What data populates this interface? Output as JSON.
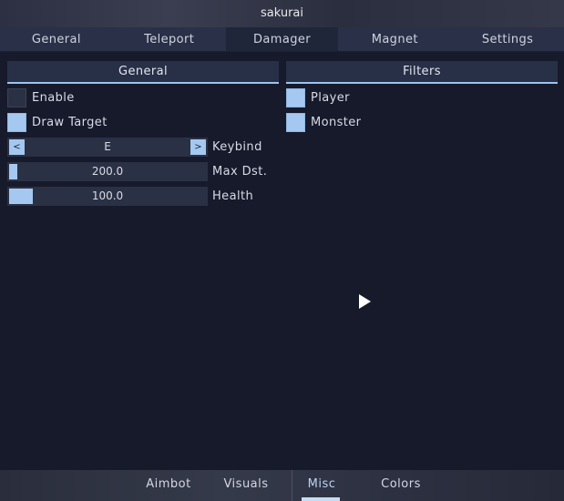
{
  "window": {
    "title": "sakurai"
  },
  "tabs": [
    {
      "label": "General"
    },
    {
      "label": "Teleport"
    },
    {
      "label": "Damager",
      "active": true
    },
    {
      "label": "Magnet"
    },
    {
      "label": "Settings"
    }
  ],
  "general_panel": {
    "title": "General",
    "enable": {
      "label": "Enable",
      "checked": false
    },
    "draw_target": {
      "label": "Draw Target",
      "checked": true
    },
    "keybind": {
      "label": "Keybind",
      "value": "E",
      "left_arrow": "<",
      "right_arrow": ">"
    },
    "max_dst": {
      "label": "Max Dst.",
      "value": "200.0",
      "fill_fraction": 0.04
    },
    "health": {
      "label": "Health",
      "value": "100.0",
      "fill_fraction": 0.12
    }
  },
  "filters_panel": {
    "title": "Filters",
    "player": {
      "label": "Player",
      "checked": true
    },
    "monster": {
      "label": "Monster",
      "checked": true
    }
  },
  "bottom_tabs": [
    {
      "label": "Aimbot"
    },
    {
      "label": "Visuals"
    },
    {
      "label": "Misc",
      "active": true
    },
    {
      "label": "Colors"
    }
  ],
  "colors": {
    "accent": "#a4c8f0",
    "background": "#161a2b",
    "panel_header": "#283048"
  }
}
